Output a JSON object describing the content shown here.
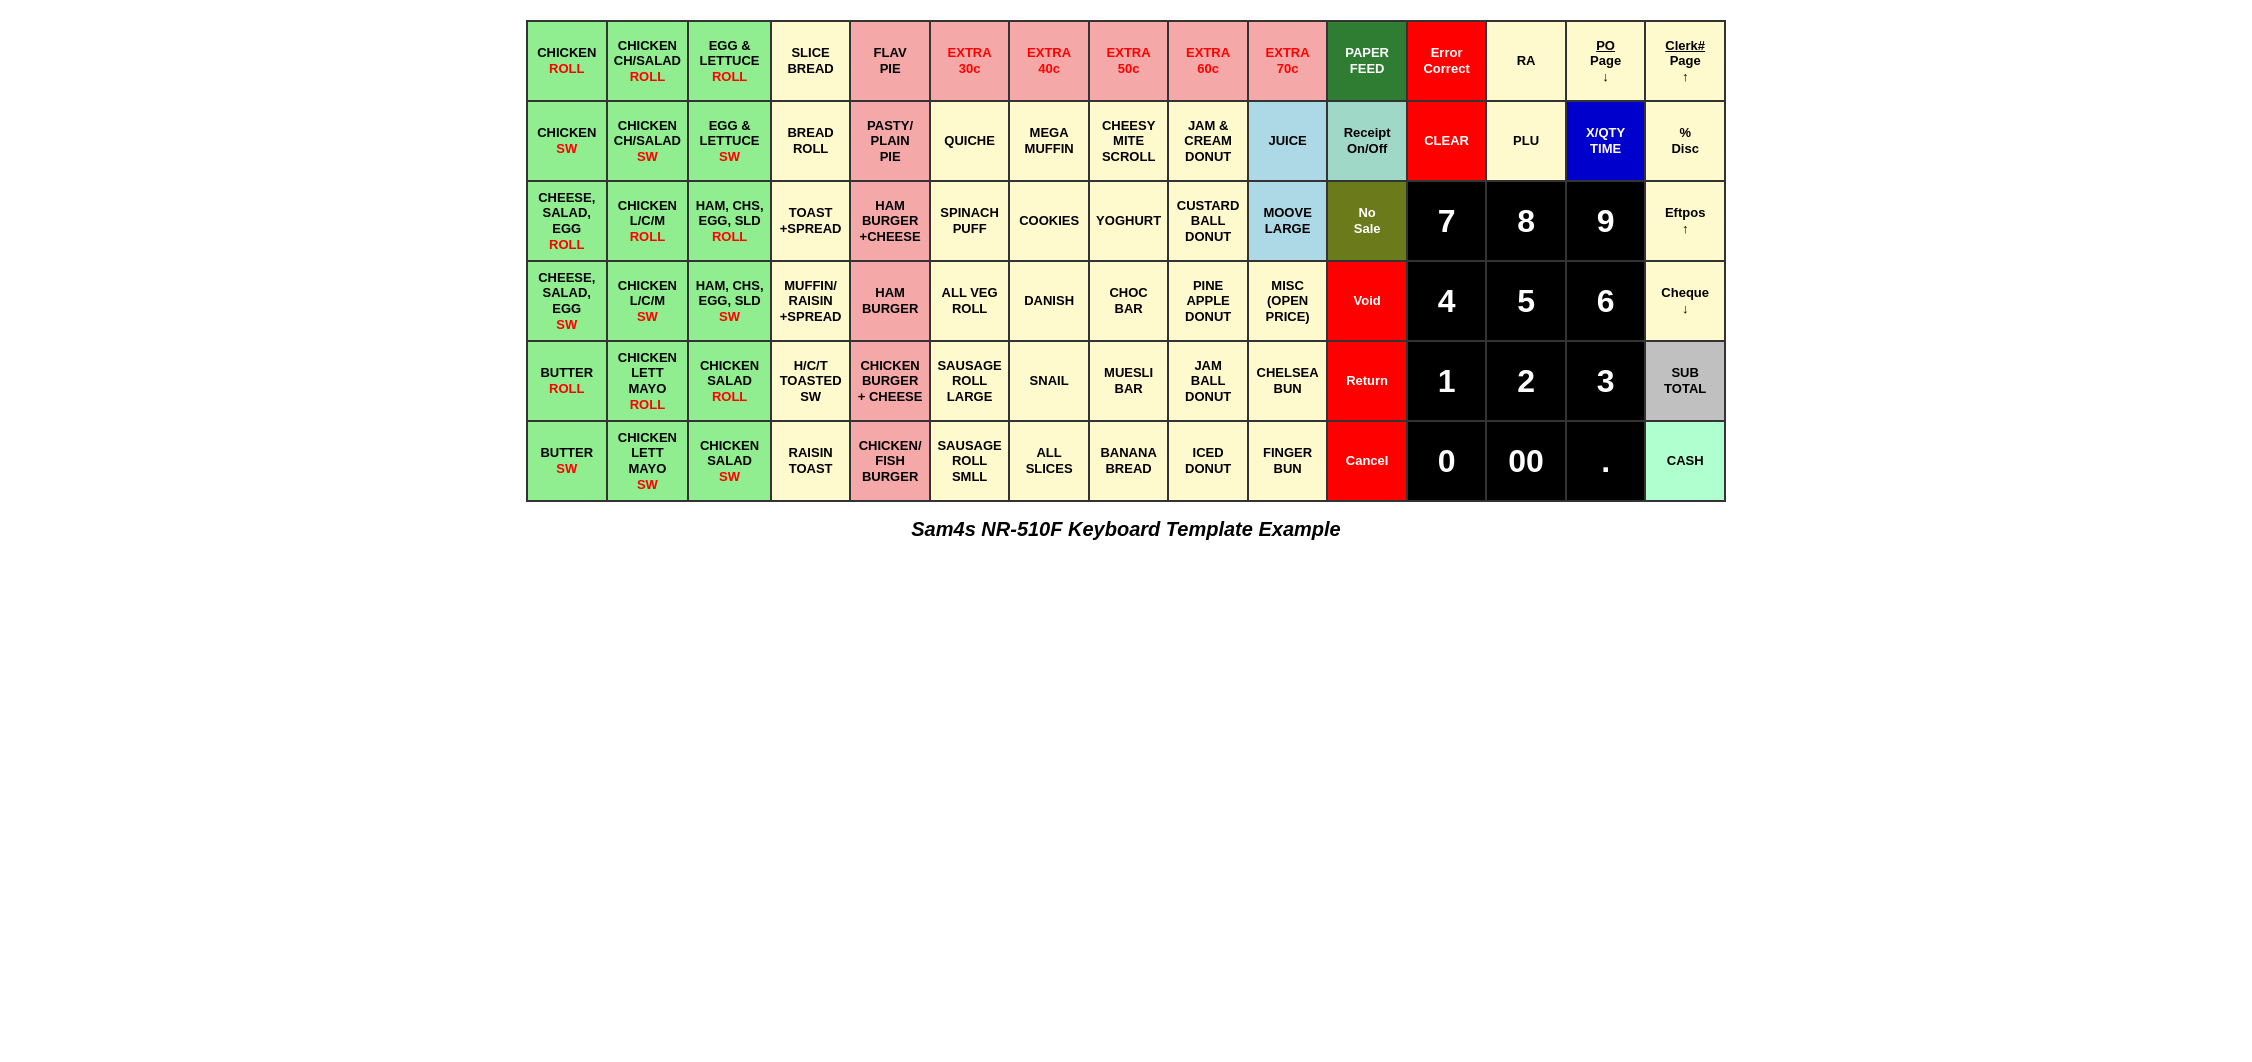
{
  "title": "Sam4s NR-510F Keyboard Template Example",
  "rows": [
    {
      "cells": [
        {
          "label": "CHICKEN\nROLL",
          "parts": [
            {
              "text": "CHICKEN",
              "color": "black"
            },
            {
              "text": "ROLL",
              "color": "red"
            }
          ],
          "bg": "green-light"
        },
        {
          "label": "CHICKEN\nCH/SALAD\nROLL",
          "parts": [
            {
              "text": "CHICKEN\nCH/SALAD",
              "color": "black"
            },
            {
              "text": "ROLL",
              "color": "red"
            }
          ],
          "bg": "green-light"
        },
        {
          "label": "EGG &\nLETTUCE\nROLL",
          "parts": [
            {
              "text": "EGG &\nLETTUCE",
              "color": "black"
            },
            {
              "text": "ROLL",
              "color": "red"
            }
          ],
          "bg": "green-light"
        },
        {
          "label": "SLICE\nBREAD",
          "bg": "yellow-light"
        },
        {
          "label": "FLAV\nPIE",
          "bg": "salmon"
        },
        {
          "label": "EXTRA\n30c",
          "parts": [
            {
              "text": "EXTRA\n30c",
              "color": "red"
            }
          ],
          "bg": "salmon"
        },
        {
          "label": "EXTRA\n40c",
          "parts": [
            {
              "text": "EXTRA\n40c",
              "color": "red"
            }
          ],
          "bg": "salmon"
        },
        {
          "label": "EXTRA\n50c",
          "parts": [
            {
              "text": "EXTRA\n50c",
              "color": "red"
            }
          ],
          "bg": "salmon"
        },
        {
          "label": "EXTRA\n60c",
          "parts": [
            {
              "text": "EXTRA\n60c",
              "color": "red"
            }
          ],
          "bg": "salmon"
        },
        {
          "label": "EXTRA\n70c",
          "parts": [
            {
              "text": "EXTRA\n70c",
              "color": "red"
            }
          ],
          "bg": "salmon"
        },
        {
          "label": "PAPER\nFEED",
          "bg": "dark-green"
        },
        {
          "label": "Error\nCorrect",
          "bg": "red"
        },
        {
          "label": "RA",
          "bg": "yellow-light"
        },
        {
          "label": "PO\nPage\n↓",
          "bg": "yellow-light",
          "underline": true
        },
        {
          "label": "Clerk#\nPage\n↑",
          "bg": "yellow-light",
          "underline": true
        }
      ]
    },
    {
      "cells": [
        {
          "label": "CHICKEN\nSW",
          "parts": [
            {
              "text": "CHICKEN",
              "color": "black"
            },
            {
              "text": "SW",
              "color": "red"
            }
          ],
          "bg": "green-light"
        },
        {
          "label": "CHICKEN\nCH/SALAD\nSW",
          "parts": [
            {
              "text": "CHICKEN\nCH/SALAD",
              "color": "black"
            },
            {
              "text": "SW",
              "color": "red"
            }
          ],
          "bg": "green-light"
        },
        {
          "label": "EGG &\nLETTUCE\nSW",
          "parts": [
            {
              "text": "EGG &\nLETTUCE",
              "color": "black"
            },
            {
              "text": "SW",
              "color": "red"
            }
          ],
          "bg": "green-light"
        },
        {
          "label": "BREAD\nROLL",
          "bg": "yellow-light"
        },
        {
          "label": "PASTY/\nPLAIN\nPIE",
          "bg": "salmon"
        },
        {
          "label": "QUICHE",
          "bg": "yellow-light"
        },
        {
          "label": "MEGA\nMUFFIN",
          "bg": "yellow-light"
        },
        {
          "label": "CHEESY\nMITE\nSCROLL",
          "bg": "yellow-light"
        },
        {
          "label": "JAM &\nCREAM\nDONUT",
          "bg": "yellow-light"
        },
        {
          "label": "JUICE",
          "bg": "blue-light"
        },
        {
          "label": "Receipt\nOn/Off",
          "bg": "teal-light"
        },
        {
          "label": "CLEAR",
          "bg": "red"
        },
        {
          "label": "PLU",
          "bg": "yellow-light"
        },
        {
          "label": "X/QTY\nTIME",
          "bg": "blue-dark"
        },
        {
          "label": "%\nDisc",
          "bg": "yellow-light"
        }
      ]
    },
    {
      "cells": [
        {
          "label": "CHEESE,\nSALAD,\nEGG ROLL",
          "parts": [
            {
              "text": "CHEESE,\nSALAD,\nEGG ",
              "color": "black"
            },
            {
              "text": "ROLL",
              "color": "red"
            }
          ],
          "bg": "green-light"
        },
        {
          "label": "CHICKEN\nL/C/M\nROLL",
          "parts": [
            {
              "text": "CHICKEN\nL/C/M",
              "color": "black"
            },
            {
              "text": "ROLL",
              "color": "red"
            }
          ],
          "bg": "green-light"
        },
        {
          "label": "HAM, CHS,\nEGG, SLD\nROLL",
          "parts": [
            {
              "text": "HAM, CHS,\nEGG, SLD",
              "color": "black"
            },
            {
              "text": "ROLL",
              "color": "red"
            }
          ],
          "bg": "green-light"
        },
        {
          "label": "TOAST\n+SPREAD",
          "bg": "yellow-light"
        },
        {
          "label": "HAM\nBURGER\n+CHEESE",
          "bg": "salmon"
        },
        {
          "label": "SPINACH\nPUFF",
          "bg": "yellow-light"
        },
        {
          "label": "COOKIES",
          "bg": "yellow-light"
        },
        {
          "label": "YOGHURT",
          "bg": "yellow-light"
        },
        {
          "label": "CUSTARD\nBALL\nDONUT",
          "bg": "yellow-light"
        },
        {
          "label": "MOOVE\nLARGE",
          "bg": "blue-light"
        },
        {
          "label": "No\nSale",
          "bg": "olive"
        },
        {
          "label": "7",
          "bg": "black",
          "fontsize": "large"
        },
        {
          "label": "8",
          "bg": "black",
          "fontsize": "large"
        },
        {
          "label": "9",
          "bg": "black",
          "fontsize": "large"
        },
        {
          "label": "Eftpos\n↑",
          "bg": "yellow-light"
        }
      ]
    },
    {
      "cells": [
        {
          "label": "CHEESE,\nSALAD,\nEGG SW",
          "parts": [
            {
              "text": "CHEESE,\nSALAD,\nEGG ",
              "color": "black"
            },
            {
              "text": "SW",
              "color": "red"
            }
          ],
          "bg": "green-light"
        },
        {
          "label": "CHICKEN\nL/C/M\nSW",
          "parts": [
            {
              "text": "CHICKEN\nL/C/M",
              "color": "black"
            },
            {
              "text": "SW",
              "color": "red"
            }
          ],
          "bg": "green-light"
        },
        {
          "label": "HAM, CHS,\nEGG, SLD\nSW",
          "parts": [
            {
              "text": "HAM, CHS,\nEGG, SLD",
              "color": "black"
            },
            {
              "text": "SW",
              "color": "red"
            }
          ],
          "bg": "green-light"
        },
        {
          "label": "MUFFIN/\nRAISIN\n+SPREAD",
          "bg": "yellow-light"
        },
        {
          "label": "HAM\nBURGER",
          "bg": "salmon"
        },
        {
          "label": "ALL VEG\nROLL",
          "bg": "yellow-light"
        },
        {
          "label": "DANISH",
          "bg": "yellow-light"
        },
        {
          "label": "CHOC\nBAR",
          "bg": "yellow-light"
        },
        {
          "label": "PINE\nAPPLE\nDONUT",
          "bg": "yellow-light"
        },
        {
          "label": "MISC\n(OPEN\nPRICE)",
          "bg": "yellow-light"
        },
        {
          "label": "Void",
          "bg": "red"
        },
        {
          "label": "4",
          "bg": "black",
          "fontsize": "large"
        },
        {
          "label": "5",
          "bg": "black",
          "fontsize": "large"
        },
        {
          "label": "6",
          "bg": "black",
          "fontsize": "large"
        },
        {
          "label": "Cheque\n↓",
          "bg": "yellow-light"
        }
      ]
    },
    {
      "cells": [
        {
          "label": "BUTTER\nROLL",
          "parts": [
            {
              "text": "BUTTER",
              "color": "black"
            },
            {
              "text": "ROLL",
              "color": "red"
            }
          ],
          "bg": "green-light"
        },
        {
          "label": "CHICKEN\nLETT\nMAYO\nROLL",
          "parts": [
            {
              "text": "CHICKEN\nLETT\nMAYO",
              "color": "black"
            },
            {
              "text": "ROLL",
              "color": "red"
            }
          ],
          "bg": "green-light"
        },
        {
          "label": "CHICKEN\nSALAD\nROLL",
          "parts": [
            {
              "text": "CHICKEN\nSALAD",
              "color": "black"
            },
            {
              "text": "ROLL",
              "color": "red"
            }
          ],
          "bg": "green-light"
        },
        {
          "label": "H/C/T\nTOASTED\nSW",
          "bg": "yellow-light"
        },
        {
          "label": "CHICKEN\nBURGER\n+ CHEESE",
          "bg": "salmon"
        },
        {
          "label": "SAUSAGE\nROLL\nLARGE",
          "bg": "yellow-light"
        },
        {
          "label": "SNAIL",
          "bg": "yellow-light"
        },
        {
          "label": "MUESLI\nBAR",
          "bg": "yellow-light"
        },
        {
          "label": "JAM\nBALL\nDONUT",
          "bg": "yellow-light"
        },
        {
          "label": "CHELSEA\nBUN",
          "bg": "yellow-light"
        },
        {
          "label": "Return",
          "bg": "red"
        },
        {
          "label": "1",
          "bg": "black",
          "fontsize": "large"
        },
        {
          "label": "2",
          "bg": "black",
          "fontsize": "large"
        },
        {
          "label": "3",
          "bg": "black",
          "fontsize": "large"
        },
        {
          "label": "SUB\nTOTAL",
          "bg": "gray-light"
        }
      ]
    },
    {
      "cells": [
        {
          "label": "BUTTER\nSW",
          "parts": [
            {
              "text": "BUTTER",
              "color": "black"
            },
            {
              "text": "SW",
              "color": "red"
            }
          ],
          "bg": "green-light"
        },
        {
          "label": "CHICKEN\nLETT\nMAYO SW",
          "parts": [
            {
              "text": "CHICKEN\nLETT\nMAYO ",
              "color": "black"
            },
            {
              "text": "SW",
              "color": "red"
            }
          ],
          "bg": "green-light"
        },
        {
          "label": "CHICKEN\nSALAD\nSW",
          "parts": [
            {
              "text": "CHICKEN\nSALAD",
              "color": "black"
            },
            {
              "text": "SW",
              "color": "red"
            }
          ],
          "bg": "green-light"
        },
        {
          "label": "RAISIN\nTOAST",
          "bg": "yellow-light"
        },
        {
          "label": "CHICKEN/\nFISH\nBURGER",
          "bg": "salmon"
        },
        {
          "label": "SAUSAGE\nROLL\nSMLL",
          "bg": "yellow-light"
        },
        {
          "label": "ALL\nSLICES",
          "bg": "yellow-light"
        },
        {
          "label": "BANANA\nBREAD",
          "bg": "yellow-light"
        },
        {
          "label": "ICED\nDONUT",
          "bg": "yellow-light"
        },
        {
          "label": "FINGER\nBUN",
          "bg": "yellow-light"
        },
        {
          "label": "Cancel",
          "bg": "red"
        },
        {
          "label": "0",
          "bg": "black",
          "fontsize": "large"
        },
        {
          "label": "00",
          "bg": "black",
          "fontsize": "large"
        },
        {
          "label": ".",
          "bg": "black",
          "fontsize": "large"
        },
        {
          "label": "CASH",
          "bg": "mint"
        }
      ]
    }
  ]
}
